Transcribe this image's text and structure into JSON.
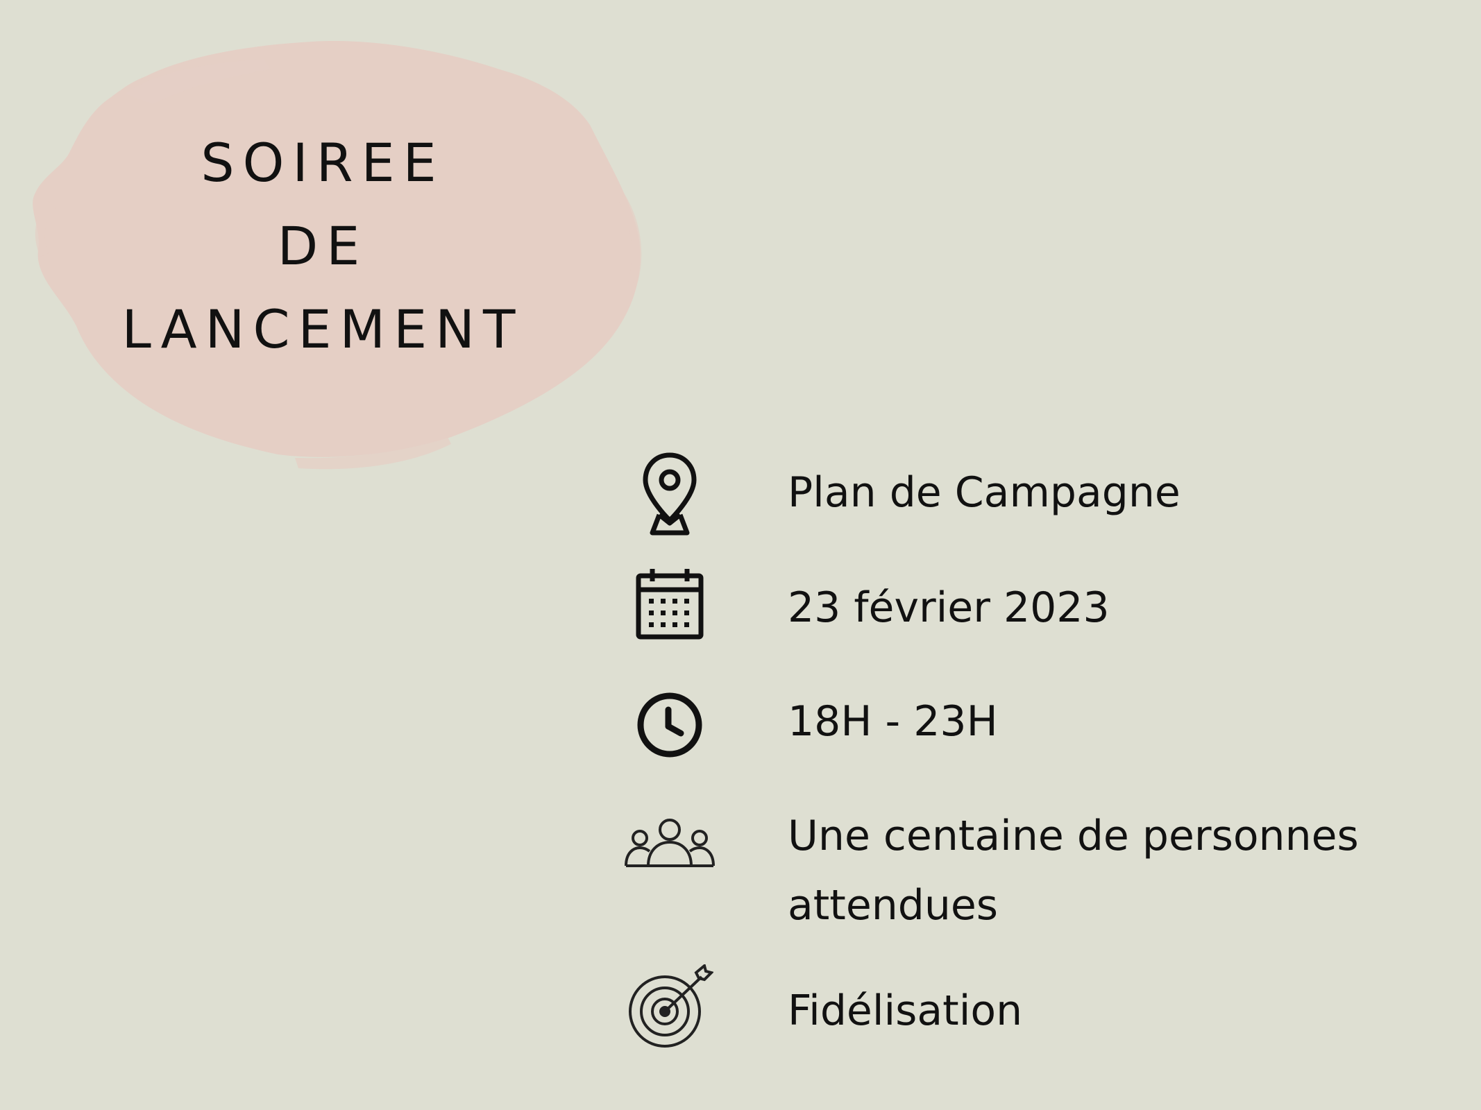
{
  "colors": {
    "background": "#dedfd2",
    "blob": "#e5cfc5",
    "text": "#111111"
  },
  "title": {
    "line1": "SOIREE",
    "line2": "DE",
    "line3": "LANCEMENT"
  },
  "details": [
    {
      "icon": "map-pin-icon",
      "text": "Plan de Campagne"
    },
    {
      "icon": "calendar-icon",
      "text": "23 février 2023"
    },
    {
      "icon": "clock-icon",
      "text": "18H - 23H"
    },
    {
      "icon": "people-group-icon",
      "text": "Une centaine de personnes attendues"
    },
    {
      "icon": "target-icon",
      "text": "Fidélisation"
    }
  ]
}
